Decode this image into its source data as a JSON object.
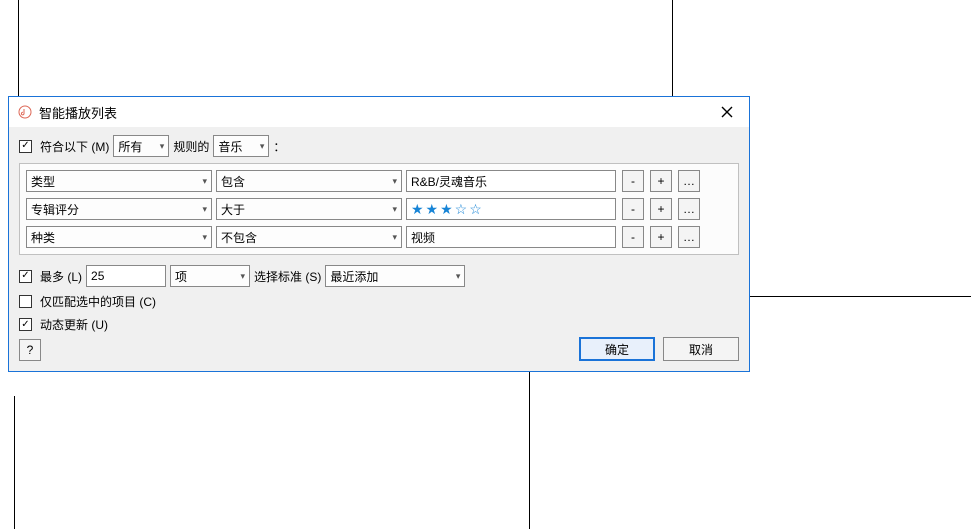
{
  "dialog": {
    "title": "智能播放列表"
  },
  "match": {
    "label": "符合以下 (M)",
    "scope": "所有",
    "rules_label": "规则的",
    "domain": "音乐",
    "suffix": "："
  },
  "rules": [
    {
      "field": "类型",
      "op": "包含",
      "value": "R&B/灵魂音乐",
      "stars": false
    },
    {
      "field": "专辑评分",
      "op": "大于",
      "value": "★★★☆☆",
      "stars": true
    },
    {
      "field": "种类",
      "op": "不包含",
      "value": "视频",
      "stars": false
    }
  ],
  "buttons": {
    "minus": "-",
    "plus": "+",
    "more": "…"
  },
  "limit": {
    "label": "最多 (L)",
    "value": "25",
    "unit": "项",
    "select_label": "选择标准 (S)",
    "select_value": "最近添加"
  },
  "checked_only": {
    "label": "仅匹配选中的项目 (C)"
  },
  "live_update": {
    "label": "动态更新 (U)"
  },
  "help": {
    "label": "?"
  },
  "footer": {
    "ok": "确定",
    "cancel": "取消"
  }
}
